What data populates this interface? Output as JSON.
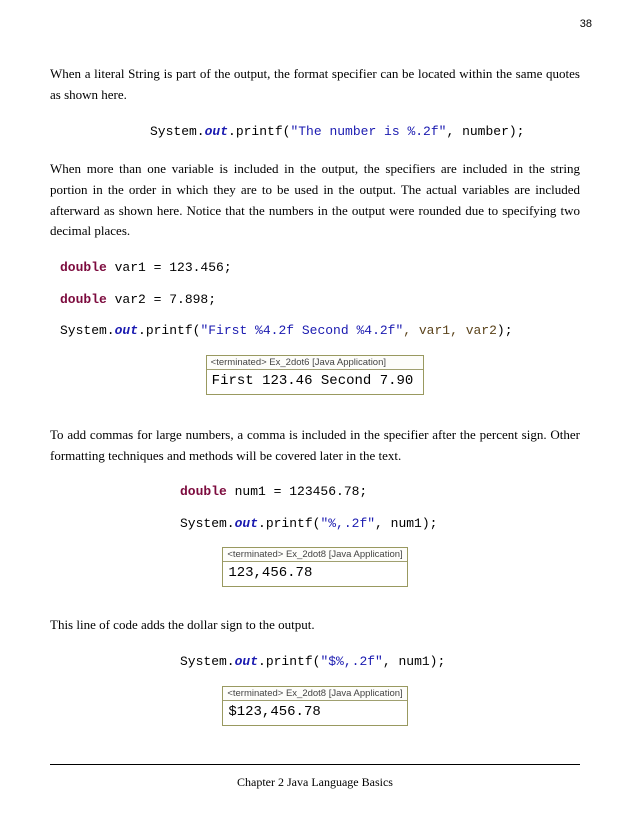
{
  "pageNumber": "38",
  "para1": "When a literal String is part of the output, the format specifier can be located within the same quotes as shown here.",
  "code1": {
    "pre": "System.",
    "out": "out",
    "printf": ".printf(",
    "str": "\"The number is %.2f\"",
    "tail": ", number);"
  },
  "para2": "When more than one variable is included in the output, the specifiers are included in the string portion in the order in which they are to be used in the output.  The actual variables are included afterward as shown here.  Notice that the numbers in the output were rounded due to specifying two decimal places.",
  "code2a": {
    "kw": "double",
    "mid": " var1 = 123.456;"
  },
  "code2b": {
    "kw": "double",
    "mid": " var2 = 7.898;"
  },
  "code2c": {
    "pre": "System.",
    "out": "out",
    "printf": ".printf(",
    "str": "\"First %4.2f Second %4.2f\"",
    "c1": ", var1",
    "c2": ", var2",
    "end": ");"
  },
  "out1": {
    "header": "<terminated> Ex_2dot6 [Java Application]",
    "body": "First 123.46 Second 7.90"
  },
  "para3": "To add commas for large numbers, a comma is included in the specifier after the percent sign.  Other formatting techniques and methods will be covered later in the text.",
  "code3a": {
    "kw": "double",
    "mid": " num1 = 123456.78;"
  },
  "code3b": {
    "pre": "System.",
    "out": "out",
    "printf": ".printf(",
    "str": "\"%,.2f\"",
    "tail": ", num1);"
  },
  "out2": {
    "header": "<terminated> Ex_2dot8 [Java Application]",
    "body": "123,456.78"
  },
  "para4": "This line of code adds the dollar sign to the output.",
  "code4": {
    "pre": "System.",
    "out": "out",
    "printf": ".printf(",
    "str": "\"$%,.2f\"",
    "tail": ", num1);"
  },
  "out3": {
    "header": "<terminated> Ex_2dot8 [Java Application]",
    "body": "$123,456.78"
  },
  "footer": "Chapter 2 Java Language Basics"
}
